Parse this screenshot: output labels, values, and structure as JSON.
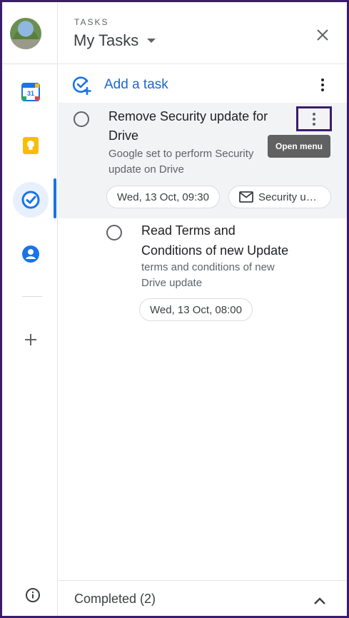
{
  "rail": {
    "items": [
      {
        "name": "calendar",
        "label": "31"
      },
      {
        "name": "keep"
      },
      {
        "name": "tasks",
        "active": true
      },
      {
        "name": "contacts"
      }
    ],
    "colors": {
      "active_bg": "#e8f0fe",
      "accent": "#1a73e8"
    }
  },
  "header": {
    "section_label": "TASKS",
    "list_title": "My Tasks"
  },
  "add_task": {
    "label": "Add a task"
  },
  "tasks": [
    {
      "title_line1": "Remove Security update for",
      "title_line2": "Drive",
      "notes_line1": "Google set to perform Security",
      "notes_line2": "update on Drive",
      "date_chip": "Wed, 13 Oct, 09:30",
      "email_chip": "Security u…",
      "menu_tooltip": "Open menu"
    },
    {
      "title_line1": "Read Terms and",
      "title_line2": "Conditions of new Update",
      "notes_line1": "terms and conditions of new",
      "notes_line2": "Drive update",
      "date_chip": "Wed, 13 Oct, 08:00"
    }
  ],
  "footer": {
    "completed_label": "Completed (2)"
  }
}
